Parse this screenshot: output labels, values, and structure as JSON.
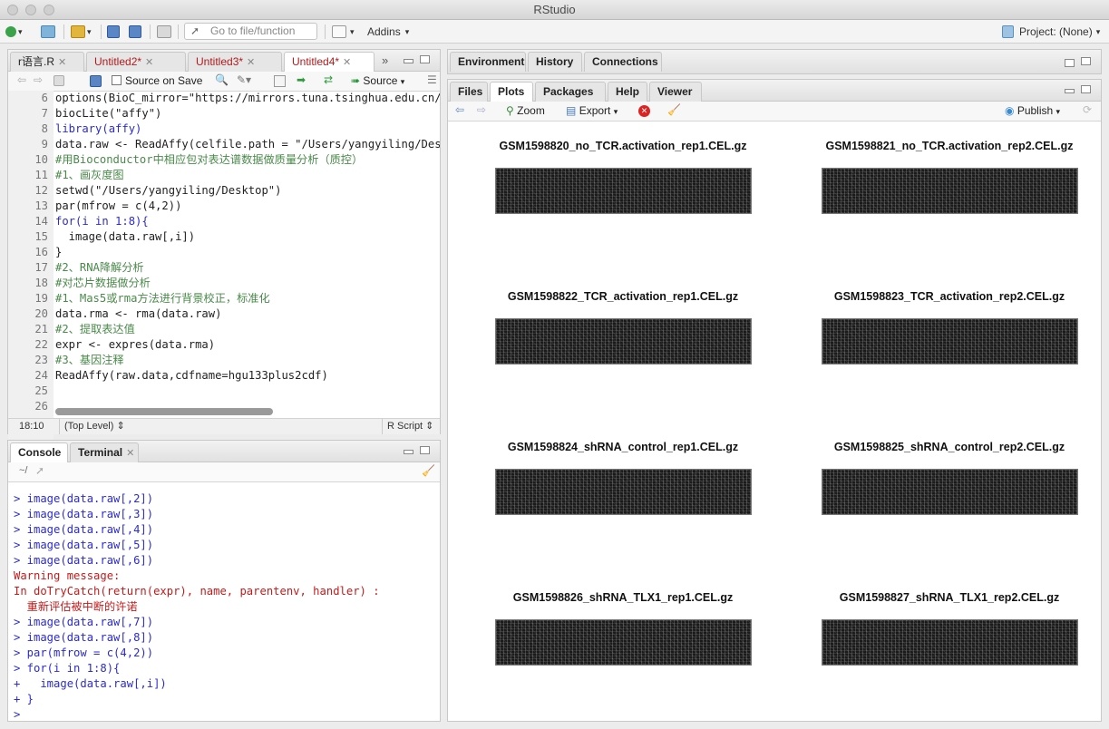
{
  "window": {
    "title": "RStudio"
  },
  "toolbar": {
    "goto_placeholder": "Go to file/function",
    "addins_label": "Addins",
    "project_label": "Project: (None)"
  },
  "source": {
    "tabs": [
      {
        "label": "r语言.R",
        "modified": false
      },
      {
        "label": "Untitled2*",
        "modified": true
      },
      {
        "label": "Untitled3*",
        "modified": true
      },
      {
        "label": "Untitled4*",
        "modified": true
      }
    ],
    "source_on_save": "Source on Save",
    "source_button": "Source",
    "lines": [
      {
        "n": "6",
        "text": "options(BioC_mirror=\"https://mirrors.tuna.tsinghua.edu.cn/b"
      },
      {
        "n": "7",
        "text": "biocLite(\"affy\")"
      },
      {
        "n": "8",
        "text": "library(affy)"
      },
      {
        "n": "9",
        "text": "data.raw <- ReadAffy(celfile.path = \"/Users/yangyiling/Desk"
      },
      {
        "n": "10",
        "text": "#用Bioconductor中相应包对表达谱数据做质量分析（质控）"
      },
      {
        "n": "11",
        "text": "#1、画灰度图"
      },
      {
        "n": "12",
        "text": "setwd(\"/Users/yangyiling/Desktop\")"
      },
      {
        "n": "13",
        "text": "par(mfrow = c(4,2))"
      },
      {
        "n": "14",
        "text": "for(i in 1:8){"
      },
      {
        "n": "15",
        "text": "  image(data.raw[,i])"
      },
      {
        "n": "16",
        "text": "}"
      },
      {
        "n": "17",
        "text": "#2、RNA降解分析"
      },
      {
        "n": "18",
        "text": "#对芯片数据做分析"
      },
      {
        "n": "19",
        "text": "#1、Mas5或rma方法进行背景校正，标准化"
      },
      {
        "n": "20",
        "text": "data.rma <- rma(data.raw)"
      },
      {
        "n": "21",
        "text": "#2、提取表达值"
      },
      {
        "n": "22",
        "text": "expr <- expres(data.rma)"
      },
      {
        "n": "23",
        "text": "#3、基因注释"
      },
      {
        "n": "24",
        "text": "ReadAffy(raw.data,cdfname=hgu133plus2cdf)"
      },
      {
        "n": "25",
        "text": ""
      },
      {
        "n": "26",
        "text": ""
      }
    ],
    "status": {
      "position": "18:10",
      "scope": "(Top Level)",
      "filetype": "R Script"
    }
  },
  "console": {
    "tabs": [
      "Console",
      "Terminal"
    ],
    "path": "~/",
    "lines": [
      {
        "cls": "blue",
        "text": "> image(data.raw[,2])"
      },
      {
        "cls": "blue",
        "text": "> image(data.raw[,3])"
      },
      {
        "cls": "blue",
        "text": "> image(data.raw[,4])"
      },
      {
        "cls": "blue",
        "text": "> image(data.raw[,5])"
      },
      {
        "cls": "blue",
        "text": "> image(data.raw[,6])"
      },
      {
        "cls": "red",
        "text": "Warning message:"
      },
      {
        "cls": "red",
        "text": "In doTryCatch(return(expr), name, parentenv, handler) :"
      },
      {
        "cls": "red",
        "text": "  重新评估被中断的许诺"
      },
      {
        "cls": "blue",
        "text": "> image(data.raw[,7])"
      },
      {
        "cls": "blue",
        "text": "> image(data.raw[,8])"
      },
      {
        "cls": "blue",
        "text": "> par(mfrow = c(4,2))"
      },
      {
        "cls": "blue",
        "text": "> for(i in 1:8){"
      },
      {
        "cls": "blue",
        "text": "+   image(data.raw[,i])"
      },
      {
        "cls": "blue",
        "text": "+ }"
      },
      {
        "cls": "blue",
        "text": "> "
      }
    ]
  },
  "env": {
    "tabs": [
      "Environment",
      "History",
      "Connections"
    ]
  },
  "files": {
    "tabs": [
      "Files",
      "Plots",
      "Packages",
      "Help",
      "Viewer"
    ],
    "zoom": "Zoom",
    "export": "Export",
    "publish": "Publish"
  },
  "plots": [
    "GSM1598820_no_TCR.activation_rep1.CEL.gz",
    "GSM1598821_no_TCR.activation_rep2.CEL.gz",
    "GSM1598822_TCR_activation_rep1.CEL.gz",
    "GSM1598823_TCR_activation_rep2.CEL.gz",
    "GSM1598824_shRNA_control_rep1.CEL.gz",
    "GSM1598825_shRNA_control_rep2.CEL.gz",
    "GSM1598826_shRNA_TLX1_rep1.CEL.gz",
    "GSM1598827_shRNA_TLX1_rep2.CEL.gz"
  ]
}
